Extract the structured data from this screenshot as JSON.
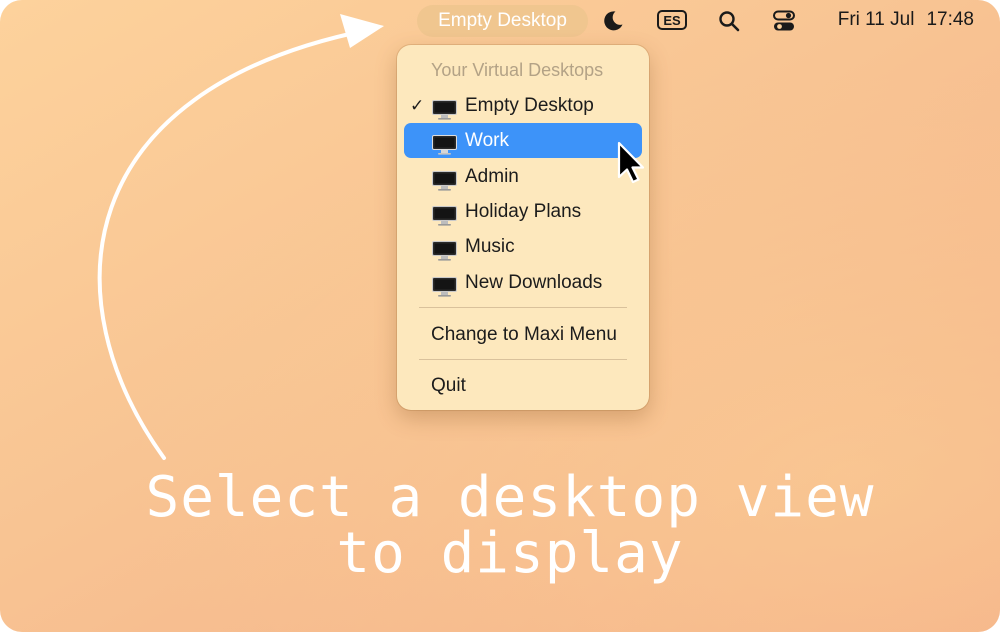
{
  "menubar": {
    "app_label": "Empty Desktop",
    "icons": [
      "moon-icon",
      "input-source-icon",
      "search-icon",
      "control-center-icon"
    ],
    "input_source": "ES",
    "date": "Fri 11 Jul",
    "time": "17:48"
  },
  "menu": {
    "header": "Your Virtual Desktops",
    "desktops": [
      {
        "label": "Empty Desktop",
        "checked": true
      },
      {
        "label": "Work",
        "highlighted": true
      },
      {
        "label": "Admin"
      },
      {
        "label": "Holiday Plans"
      },
      {
        "label": "Music"
      },
      {
        "label": "New Downloads"
      }
    ],
    "check_mark": "✓",
    "change_label": "Change to Maxi Menu",
    "quit_label": "Quit"
  },
  "caption": {
    "line1": "Select a desktop view",
    "line2": "to display"
  },
  "colors": {
    "highlight": "#3d93f9",
    "menu_bg": "#fde8bd",
    "background_top": "#fdd29c",
    "background_bottom": "#f4ae88"
  }
}
